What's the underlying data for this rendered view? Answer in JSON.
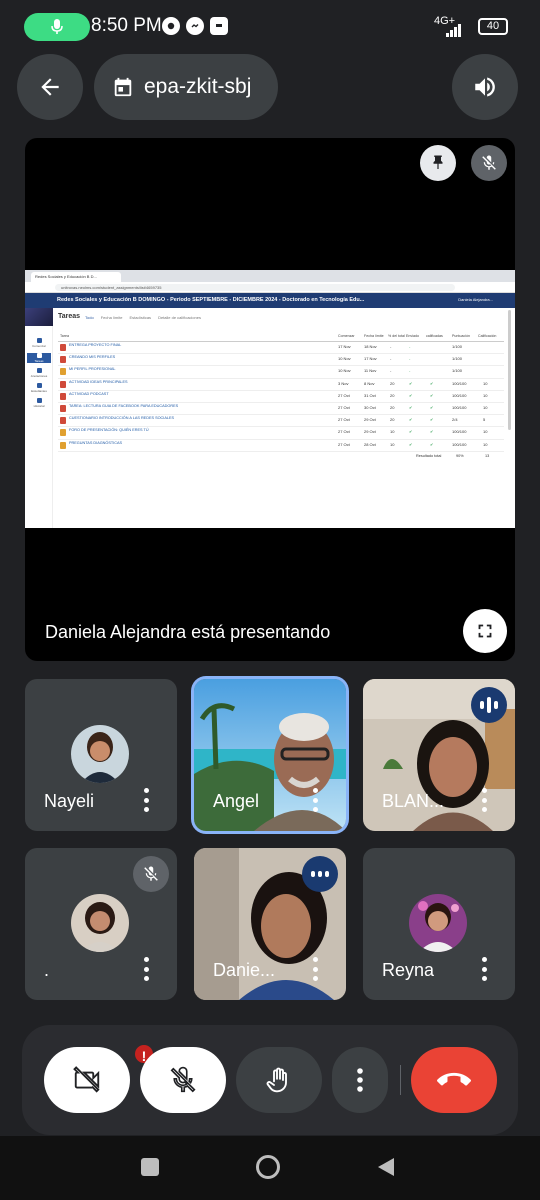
{
  "status_bar": {
    "time": "8:50 PM",
    "network": "4G+",
    "battery": "40"
  },
  "header": {
    "meeting_code": "epa-zkit-sbj"
  },
  "presentation": {
    "presenter_text": "Daniela Alejandra está presentando",
    "shared_screen": {
      "tab_title": "Redes Sociales y Educación B D...",
      "url": "unitrovas.neolms.com/student_assignments/list/4659735",
      "course_title": "Redes Sociales y Educación B DOMINGO - Periodo SEPTIEMBRE - DICIEMBRE 2024 - Doctorado en Tecnología Edu...",
      "user_name": "Daniela Alejandra...",
      "page_title": "Tareas",
      "subtabs": [
        "Todo",
        "Fecha límite",
        "Estadísticas",
        "Detalle de calificaciones"
      ],
      "sidebar": [
        "Comenzar",
        "Tareas",
        "Anotaciones",
        "Estudiantes",
        "Historial"
      ],
      "columns": [
        "Tarea",
        "Comenzar",
        "Fecha límite",
        "% del total",
        "Enviado",
        "calificadas",
        "Puntuación",
        "Calificación"
      ],
      "rows": [
        {
          "name": "ENTREGA PROYECTO FINAL",
          "start": "17 Nov",
          "due": "18 Nov",
          "pct": "-",
          "sent": "-",
          "graded": "",
          "score": "1/100",
          "grade": ""
        },
        {
          "name": "CREANDO MIS PERFILES",
          "start": "10 Nov",
          "due": "17 Nov",
          "pct": "-",
          "sent": "-",
          "graded": "",
          "score": "1/100",
          "grade": ""
        },
        {
          "name": "MI PERFIL PROFESIONAL",
          "start": "10 Nov",
          "due": "11 Nov",
          "pct": "-",
          "sent": "-",
          "graded": "",
          "score": "1/100",
          "grade": ""
        },
        {
          "name": "ACTIVIDAD IDEAS PRINCIPALES",
          "start": "3 Nov",
          "due": "8 Nov",
          "pct": "20",
          "sent": "✔",
          "graded": "✔",
          "score": "100/100",
          "grade": "10"
        },
        {
          "name": "ACTIVIDAD PODCAST",
          "start": "27 Oct",
          "due": "31 Oct",
          "pct": "20",
          "sent": "✔",
          "graded": "✔",
          "score": "100/100",
          "grade": "10"
        },
        {
          "name": "TAREA: LECTURA GUIA DE FACEBOOK PARA EDUCADORES",
          "start": "27 Oct",
          "due": "30 Oct",
          "pct": "20",
          "sent": "✔",
          "graded": "✔",
          "score": "100/100",
          "grade": "10"
        },
        {
          "name": "CUESTIONARIO INTRODUCCIÓN A LAS REDES SOCIALES",
          "start": "27 Oct",
          "due": "29 Oct",
          "pct": "20",
          "sent": "✔",
          "graded": "✔",
          "score": "2/4",
          "grade": "5"
        },
        {
          "name": "FORO DE PRESENTACIÓN: QUIÉN ERES TÚ",
          "start": "27 Oct",
          "due": "29 Oct",
          "pct": "10",
          "sent": "✔",
          "graded": "✔",
          "score": "100/100",
          "grade": "10"
        },
        {
          "name": "PREGUNTAS DIAGNÓSTICAS",
          "start": "27 Oct",
          "due": "28 Oct",
          "pct": "10",
          "sent": "✔",
          "graded": "✔",
          "score": "100/100",
          "grade": "10"
        }
      ],
      "total_label": "Resultado total",
      "total_pct": "90%",
      "total_grade": "13"
    }
  },
  "participants": [
    {
      "name": "Nayeli",
      "type": "avatar",
      "avatar_color": "#2a3a4a",
      "muted": false,
      "speaking": false
    },
    {
      "name": "Angel",
      "type": "video",
      "muted": false,
      "speaking": false,
      "active": true
    },
    {
      "name": "BLAN...",
      "type": "video",
      "muted": false,
      "speaking": true
    },
    {
      "name": ".",
      "type": "avatar",
      "avatar_color": "#3a3a3a",
      "muted": true,
      "speaking": false
    },
    {
      "name": "Danie...",
      "type": "video",
      "muted": false,
      "speaking": true
    },
    {
      "name": "Reyna",
      "type": "avatar",
      "avatar_color": "#6b2a6a",
      "muted": false,
      "speaking": false
    }
  ],
  "controls": {
    "camera_badge": "!"
  },
  "colors": {
    "background": "#202124",
    "tile": "#3c4043",
    "end_call": "#ea4335",
    "active_border": "#8ab4f8"
  }
}
